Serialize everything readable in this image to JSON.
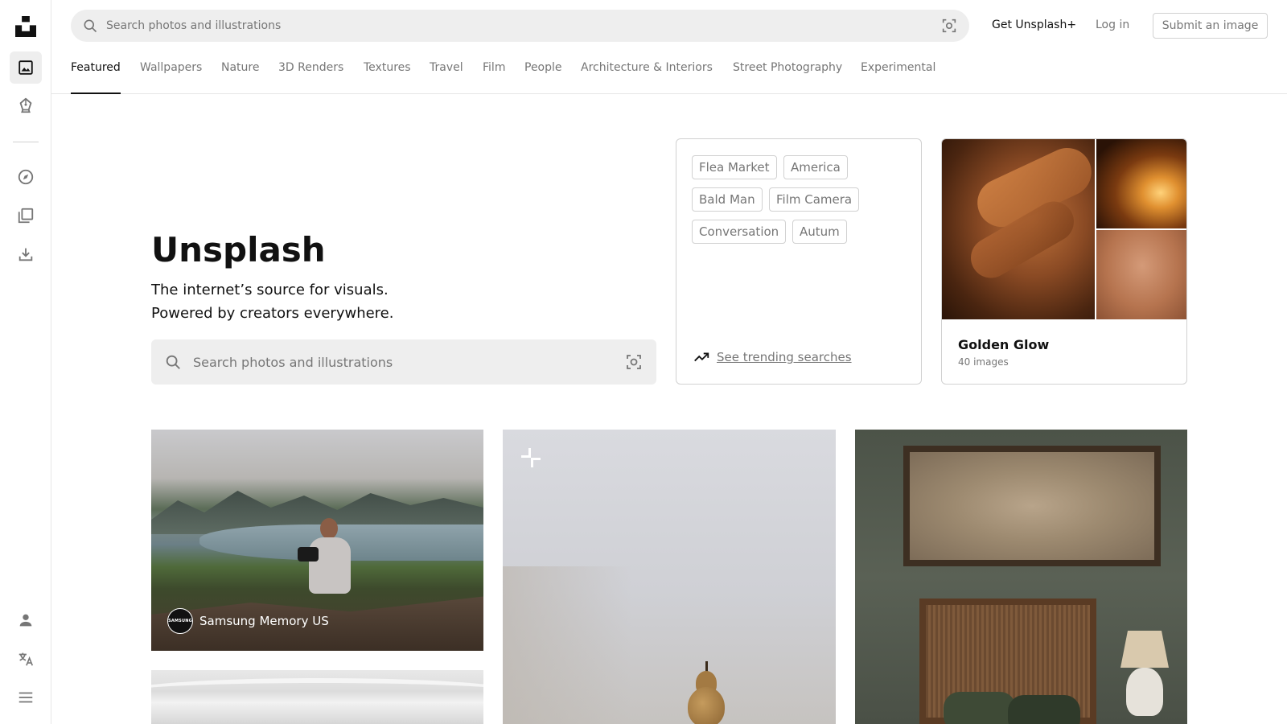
{
  "topbar": {
    "search_placeholder": "Search photos and illustrations",
    "get_plus": "Get Unsplash+",
    "login": "Log in",
    "submit": "Submit an image"
  },
  "rail": {
    "items": [
      "logo-icon",
      "photos-icon",
      "illustrations-icon",
      "explore-icon",
      "collections-icon",
      "download-icon",
      "account-icon",
      "language-icon",
      "menu-icon"
    ]
  },
  "topics": [
    "Featured",
    "Wallpapers",
    "Nature",
    "3D Renders",
    "Textures",
    "Travel",
    "Film",
    "People",
    "Architecture & Interiors",
    "Street Photography",
    "Experimental"
  ],
  "hero": {
    "title": "Unsplash",
    "line1": "The internet’s source for visuals.",
    "line2": "Powered by creators everywhere.",
    "search_placeholder": "Search photos and illustrations"
  },
  "trending": {
    "chips": [
      "Flea Market",
      "America",
      "Bald Man",
      "Film Camera",
      "Conversation",
      "Autum"
    ],
    "link": "See trending searches"
  },
  "collection": {
    "title": "Golden Glow",
    "count": "40 images"
  },
  "photos": {
    "first_credit": {
      "avatar_text": "SAMSUNG",
      "name": "Samsung Memory US"
    }
  },
  "colors": {
    "text": "#111111",
    "muted": "#767676",
    "border": "#d1d1d1",
    "search_bg": "#eeeeee"
  }
}
